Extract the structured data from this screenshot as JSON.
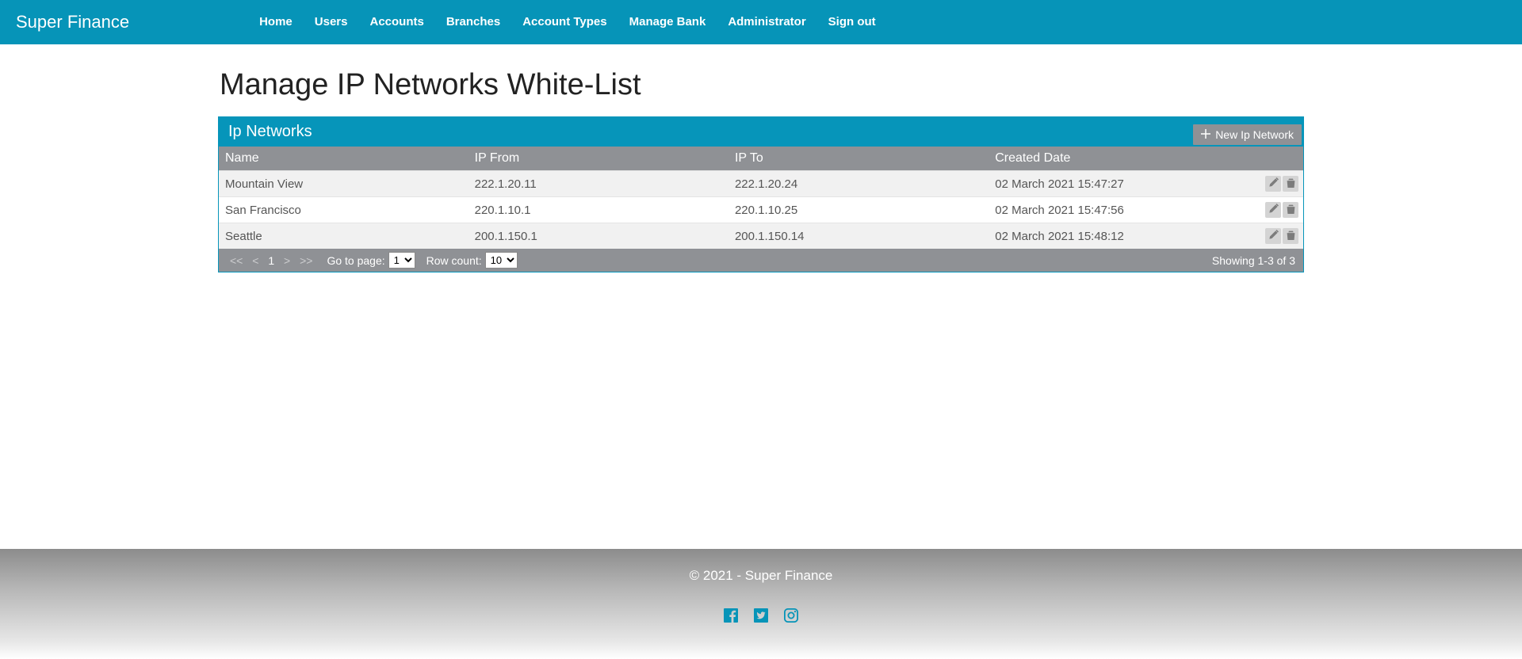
{
  "brand": "Super Finance",
  "nav": [
    "Home",
    "Users",
    "Accounts",
    "Branches",
    "Account Types",
    "Manage Bank",
    "Administrator",
    "Sign out"
  ],
  "page": {
    "title": "Manage IP Networks White-List"
  },
  "panel": {
    "header": "Ip Networks",
    "new_button": "New Ip Network"
  },
  "table": {
    "headers": [
      "Name",
      "IP From",
      "IP To",
      "Created Date"
    ],
    "rows": [
      {
        "name": "Mountain View",
        "ip_from": "222.1.20.11",
        "ip_to": "222.1.20.24",
        "created": "02 March 2021 15:47:27"
      },
      {
        "name": "San Francisco",
        "ip_from": "220.1.10.1",
        "ip_to": "220.1.10.25",
        "created": "02 March 2021 15:47:56"
      },
      {
        "name": "Seattle",
        "ip_from": "200.1.150.1",
        "ip_to": "200.1.150.14",
        "created": "02 March 2021 15:48:12"
      }
    ]
  },
  "pager": {
    "first": "<<",
    "prev": "<",
    "current_page": "1",
    "next": ">",
    "last": ">>",
    "goto_label": "Go to page:",
    "goto_value": "1",
    "rowcount_label": "Row count:",
    "rowcount_value": "10",
    "showing": "Showing 1-3 of 3"
  },
  "footer": {
    "copy": "© 2021 - Super Finance"
  }
}
